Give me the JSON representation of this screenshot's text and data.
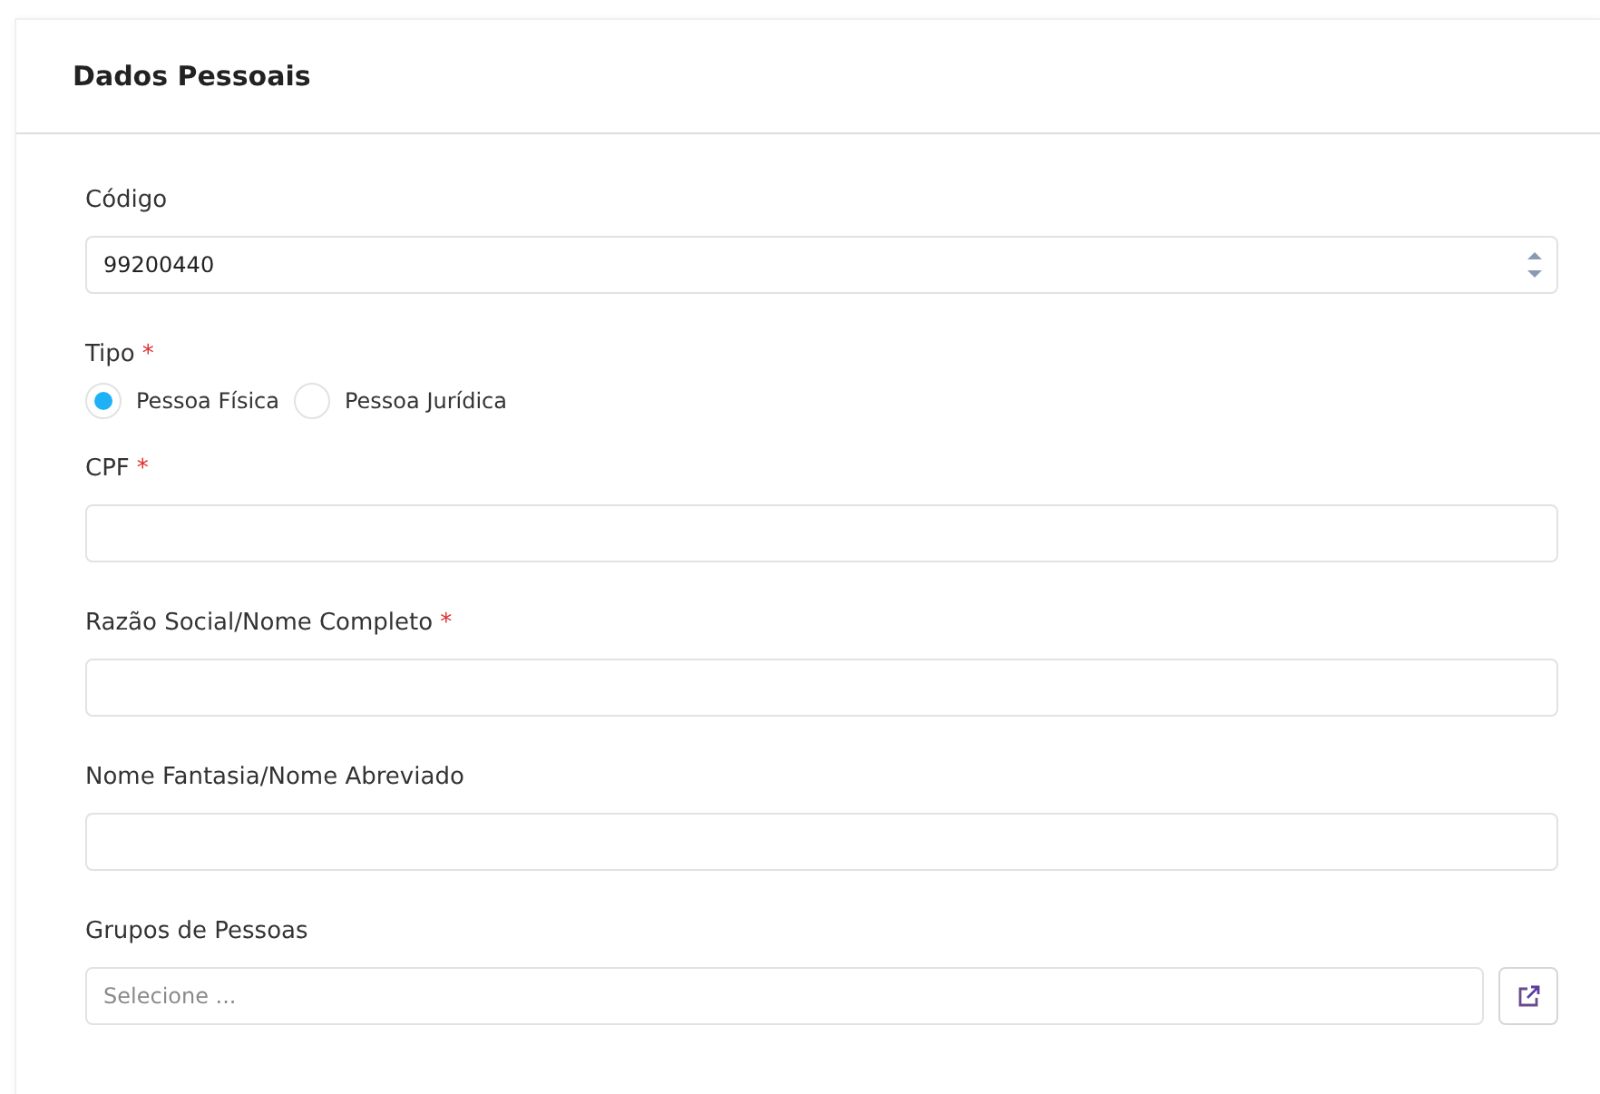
{
  "card": {
    "title": "Dados Pessoais"
  },
  "fields": [
    {
      "kind": "number",
      "label": "Código",
      "required": false,
      "value": "99200440"
    },
    {
      "kind": "radio",
      "label": "Tipo",
      "required": true,
      "options": [
        {
          "label": "Pessoa Física",
          "selected": true
        },
        {
          "label": "Pessoa Jurídica",
          "selected": false
        }
      ]
    },
    {
      "kind": "text",
      "label": "CPF",
      "required": true
    },
    {
      "kind": "text",
      "label": "Razão Social/Nome Completo",
      "required": true
    },
    {
      "kind": "text",
      "label": "Nome Fantasia/Nome Abreviado",
      "required": false
    },
    {
      "kind": "select",
      "label": "Grupos de Pessoas",
      "required": false,
      "placeholder": "Selecione ..."
    }
  ],
  "required_mark": "*"
}
